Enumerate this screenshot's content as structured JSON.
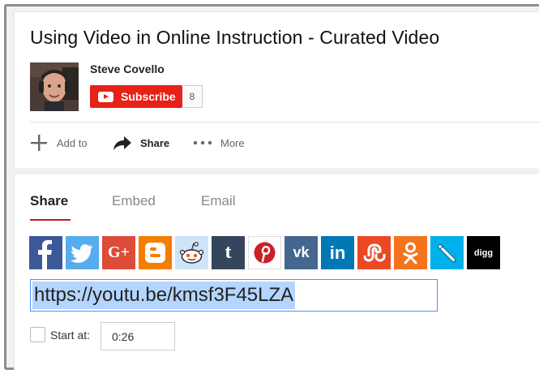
{
  "video": {
    "title": "Using Video in Online Instruction - Curated Video"
  },
  "channel": {
    "name": "Steve Covello",
    "subscribe_label": "Subscribe",
    "subscriber_count": "8"
  },
  "actions": {
    "add_to": "Add to",
    "share": "Share",
    "more": "More"
  },
  "tabs": [
    {
      "label": "Share",
      "active": true
    },
    {
      "label": "Embed",
      "active": false
    },
    {
      "label": "Email",
      "active": false
    }
  ],
  "social_networks": [
    {
      "name": "facebook",
      "icon": "facebook-icon",
      "color": "#3b5998"
    },
    {
      "name": "twitter",
      "icon": "twitter-icon",
      "color": "#55acee"
    },
    {
      "name": "google-plus",
      "icon": "google-plus-icon",
      "color": "#dd4b39"
    },
    {
      "name": "blogger",
      "icon": "blogger-icon",
      "color": "#f57d00"
    },
    {
      "name": "reddit",
      "icon": "reddit-icon",
      "color": "#cee3f8"
    },
    {
      "name": "tumblr",
      "icon": "tumblr-icon",
      "color": "#35465c"
    },
    {
      "name": "pinterest",
      "icon": "pinterest-icon",
      "color": "#cb2027"
    },
    {
      "name": "vk",
      "icon": "vk-icon",
      "color": "#45668e"
    },
    {
      "name": "linkedin",
      "icon": "linkedin-icon",
      "color": "#0077b5"
    },
    {
      "name": "stumbleupon",
      "icon": "stumbleupon-icon",
      "color": "#eb4924"
    },
    {
      "name": "odnoklassniki",
      "icon": "odnoklassniki-icon",
      "color": "#f4731c"
    },
    {
      "name": "livejournal",
      "icon": "livejournal-icon",
      "color": "#00b0ea"
    },
    {
      "name": "digg",
      "icon": "digg-icon",
      "color": "#000000",
      "text": "digg"
    }
  ],
  "share": {
    "url": "https://youtu.be/kmsf3F45LZA",
    "start_at_label": "Start at:",
    "start_at_value": "0:26",
    "start_at_checked": false
  },
  "colors": {
    "subscribe_red": "#e62117",
    "tab_underline": "#cc181e",
    "url_focus": "#4d90fe"
  }
}
